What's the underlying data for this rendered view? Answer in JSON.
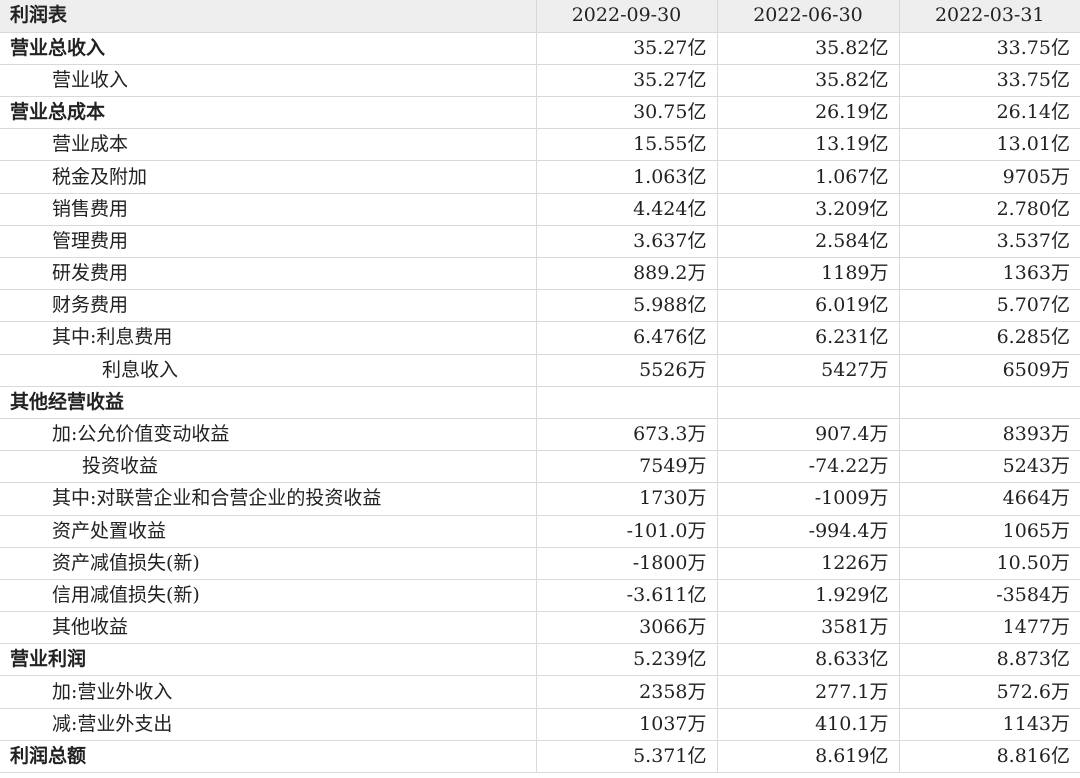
{
  "table": {
    "header": {
      "label": "利润表",
      "periods": [
        "2022-09-30",
        "2022-06-30",
        "2022-03-31"
      ]
    },
    "rows": [
      {
        "label": "营业总收入",
        "level": 0,
        "values": [
          "35.27亿",
          "35.82亿",
          "33.75亿"
        ]
      },
      {
        "label": "营业收入",
        "level": 1,
        "values": [
          "35.27亿",
          "35.82亿",
          "33.75亿"
        ]
      },
      {
        "label": "营业总成本",
        "level": 0,
        "values": [
          "30.75亿",
          "26.19亿",
          "26.14亿"
        ]
      },
      {
        "label": "营业成本",
        "level": 1,
        "values": [
          "15.55亿",
          "13.19亿",
          "13.01亿"
        ]
      },
      {
        "label": "税金及附加",
        "level": 1,
        "values": [
          "1.063亿",
          "1.067亿",
          "9705万"
        ]
      },
      {
        "label": "销售费用",
        "level": 1,
        "values": [
          "4.424亿",
          "3.209亿",
          "2.780亿"
        ]
      },
      {
        "label": "管理费用",
        "level": 1,
        "values": [
          "3.637亿",
          "2.584亿",
          "3.537亿"
        ]
      },
      {
        "label": "研发费用",
        "level": 1,
        "values": [
          "889.2万",
          "1189万",
          "1363万"
        ]
      },
      {
        "label": "财务费用",
        "level": 1,
        "values": [
          "5.988亿",
          "6.019亿",
          "5.707亿"
        ]
      },
      {
        "label": "其中:利息费用",
        "level": 1,
        "values": [
          "6.476亿",
          "6.231亿",
          "6.285亿"
        ]
      },
      {
        "label": "利息收入",
        "level": 3,
        "values": [
          "5526万",
          "5427万",
          "6509万"
        ]
      },
      {
        "label": "其他经营收益",
        "level": 0,
        "values": [
          "",
          "",
          ""
        ]
      },
      {
        "label": "加:公允价值变动收益",
        "level": 1,
        "values": [
          "673.3万",
          "907.4万",
          "8393万"
        ]
      },
      {
        "label": "投资收益",
        "level": 2,
        "values": [
          "7549万",
          "-74.22万",
          "5243万"
        ]
      },
      {
        "label": "其中:对联营企业和合营企业的投资收益",
        "level": 1,
        "values": [
          "1730万",
          "-1009万",
          "4664万"
        ]
      },
      {
        "label": "资产处置收益",
        "level": 1,
        "values": [
          "-101.0万",
          "-994.4万",
          "1065万"
        ]
      },
      {
        "label": "资产减值损失(新)",
        "level": 1,
        "values": [
          "-1800万",
          "1226万",
          "10.50万"
        ]
      },
      {
        "label": "信用减值损失(新)",
        "level": 1,
        "values": [
          "-3.611亿",
          "1.929亿",
          "-3584万"
        ]
      },
      {
        "label": "其他收益",
        "level": 1,
        "values": [
          "3066万",
          "3581万",
          "1477万"
        ]
      },
      {
        "label": "营业利润",
        "level": 0,
        "values": [
          "5.239亿",
          "8.633亿",
          "8.873亿"
        ]
      },
      {
        "label": "加:营业外收入",
        "level": 1,
        "values": [
          "2358万",
          "277.1万",
          "572.6万"
        ]
      },
      {
        "label": "减:营业外支出",
        "level": 1,
        "values": [
          "1037万",
          "410.1万",
          "1143万"
        ]
      },
      {
        "label": "利润总额",
        "level": 0,
        "values": [
          "5.371亿",
          "8.619亿",
          "8.816亿"
        ]
      }
    ]
  }
}
